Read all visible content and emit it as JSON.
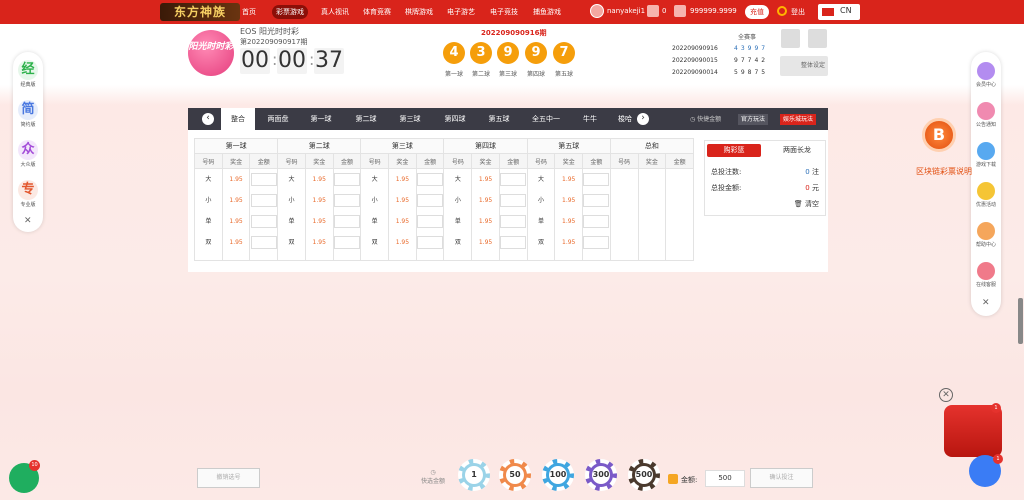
{
  "topbar": {
    "logo": "东方神族",
    "nav": [
      "首页",
      "彩票游戏",
      "真人视讯",
      "体育竞赛",
      "棋牌游戏",
      "电子游艺",
      "电子竞技",
      "捕鱼游戏"
    ],
    "active_nav": "彩票游戏",
    "username": "nanyakeji1",
    "messages": "0",
    "balance": "999999.9999",
    "deposit": "充值",
    "logout": "登出",
    "lang": "CN"
  },
  "game": {
    "logo": "阳光时时彩",
    "title": "EOS 阳光时时彩",
    "issue": "第202209090917期",
    "timer": [
      "00",
      "00",
      "37"
    ],
    "result_issue": "202209090916期",
    "balls": [
      "4",
      "3",
      "9",
      "9",
      "7"
    ],
    "ball_labels": [
      "第一球",
      "第二球",
      "第三球",
      "第四球",
      "第五球"
    ]
  },
  "history": {
    "title": "全赛事",
    "rows": [
      {
        "issue": "202209090916",
        "digits": "43997"
      },
      {
        "issue": "202209090015",
        "digits": "97742"
      },
      {
        "issue": "202209090014",
        "digits": "59875"
      }
    ],
    "color_setting": "整体设定"
  },
  "left_sidebar": {
    "items": [
      {
        "glyph": "经",
        "label": "经典版"
      },
      {
        "glyph": "简",
        "label": "简约版"
      },
      {
        "glyph": "众",
        "label": "大众版"
      },
      {
        "glyph": "专",
        "label": "专业版"
      }
    ],
    "close": "✕"
  },
  "right_sidebar": {
    "items": [
      "会员中心",
      "公告通知",
      "游戏下载",
      "优惠活动",
      "帮助中心",
      "在线客服"
    ],
    "close": "✕",
    "blockchain": "区块链彩票说明",
    "btc": "B"
  },
  "tabs": {
    "items": [
      "整合",
      "两面盘",
      "第一球",
      "第二球",
      "第三球",
      "第四球",
      "第五球",
      "全五中一",
      "牛牛",
      "梭哈"
    ],
    "active": "整合",
    "quick": "快捷金额",
    "official": "官方玩法",
    "credit": "娱乐城玩法"
  },
  "table": {
    "balls": [
      "第一球",
      "第二球",
      "第三球",
      "第四球",
      "第五球",
      "总和"
    ],
    "subheaders": [
      "号码",
      "奖金",
      "金额"
    ],
    "options": [
      "大",
      "小",
      "单",
      "双"
    ],
    "odds": "1.95"
  },
  "betslip": {
    "tab1": "购彩篮",
    "tab2": "两面长龙",
    "count_label": "总投注数:",
    "count_value": "0",
    "count_unit": "注",
    "amount_label": "总投金额:",
    "amount_value": "0",
    "amount_unit": "元",
    "clear": "清空"
  },
  "footer": {
    "cancel": "撤销选号",
    "quick": "快选金额",
    "chips": [
      "1",
      "50",
      "100",
      "300",
      "500"
    ],
    "amount_label": "金额:",
    "amount": "500",
    "confirm": "确认投注",
    "chat_badge": "10",
    "pkt_badge": "1",
    "msg_badge": "1"
  },
  "colors": {
    "brand": "#d9241b",
    "ball": "#f59e0b",
    "tabbar": "#3b3b45"
  }
}
